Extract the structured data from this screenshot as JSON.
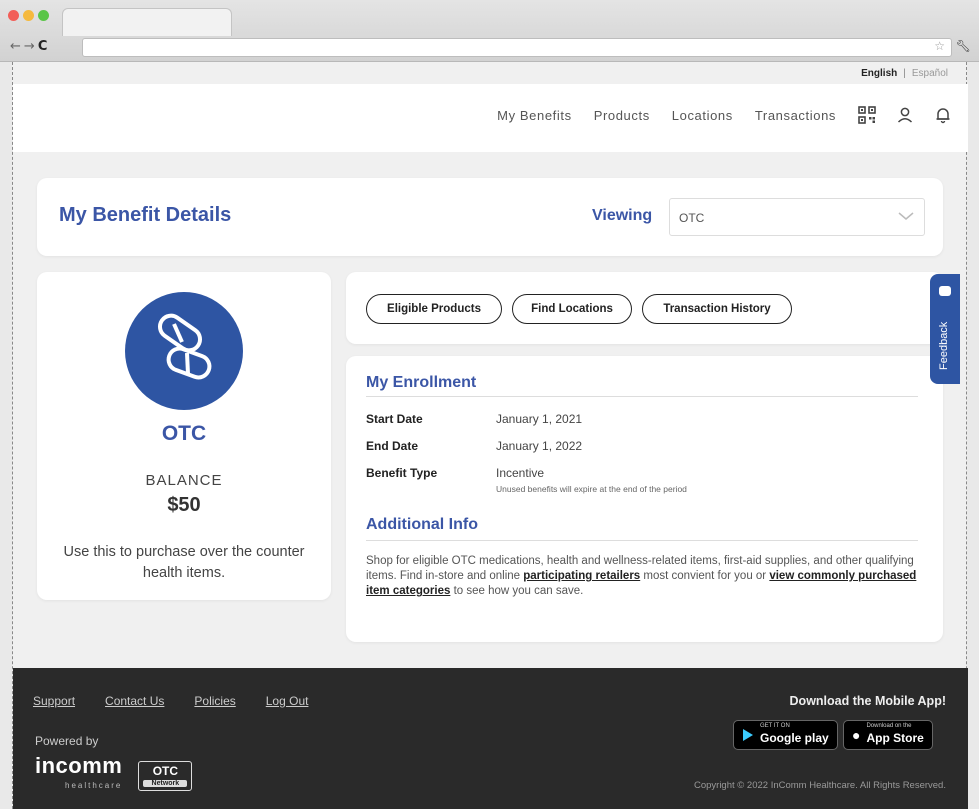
{
  "language": {
    "english": "English",
    "separator": "|",
    "spanish": "Español"
  },
  "nav": {
    "items": [
      "My Benefits",
      "Products",
      "Locations",
      "Transactions"
    ]
  },
  "benefit_header": {
    "title": "My Benefit Details",
    "viewing_label": "Viewing",
    "viewing_value": "OTC"
  },
  "benefit_summary": {
    "name": "OTC",
    "balance_label": "BALANCE",
    "balance_amount": "$50",
    "description": "Use this to purchase over the counter health items."
  },
  "actions": {
    "eligible": "Eligible Products",
    "locations": "Find Locations",
    "history": "Transaction History"
  },
  "enrollment": {
    "title": "My Enrollment",
    "start_label": "Start Date",
    "start_value": "January 1, 2021",
    "end_label": "End Date",
    "end_value": "January 1, 2022",
    "type_label": "Benefit Type",
    "type_value": "Incentive",
    "type_note": "Unused benefits will expire at the end of the period"
  },
  "additional": {
    "title": "Additional Info",
    "text1": "Shop for eligible OTC medications, health and wellness-related items, first-aid supplies, and other qualifying items. Find in-store and online ",
    "link1": "participating retailers",
    "text2": " most convient for you or ",
    "link2": "view commonly purchased item categories",
    "text3": " to see how you can save."
  },
  "feedback": {
    "label": "Feedback"
  },
  "footer": {
    "links": [
      "Support",
      "Contact Us",
      "Policies",
      "Log Out"
    ],
    "powered_by": "Powered by",
    "incomm": "incomm",
    "incomm_sub": "healthcare",
    "otc_badge": "OTC",
    "otc_badge_sub": "Network",
    "download_title": "Download the Mobile App!",
    "google_small": "GET IT ON",
    "google": "Google play",
    "apple_small": "Download on the",
    "apple": "App Store",
    "copyright": "Copyright © 2022 InComm Healthcare. All Rights Reserved."
  },
  "colors": {
    "brand_blue": "#2e55a3",
    "title_blue": "#3b56a6",
    "footer_bg": "#2a2a2a"
  }
}
